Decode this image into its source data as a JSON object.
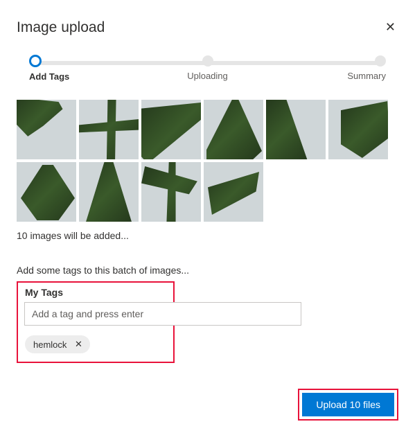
{
  "dialog": {
    "title": "Image upload"
  },
  "stepper": {
    "steps": [
      {
        "label": "Add Tags",
        "active": true
      },
      {
        "label": "Uploading",
        "active": false
      },
      {
        "label": "Summary",
        "active": false
      }
    ]
  },
  "upload": {
    "thumbnail_count": 10,
    "status_text": "10 images will be added..."
  },
  "tags": {
    "prompt": "Add some tags to this batch of images...",
    "section_heading": "My Tags",
    "input_placeholder": "Add a tag and press enter",
    "chips": [
      {
        "label": "hemlock"
      }
    ]
  },
  "actions": {
    "upload_label": "Upload 10 files"
  }
}
